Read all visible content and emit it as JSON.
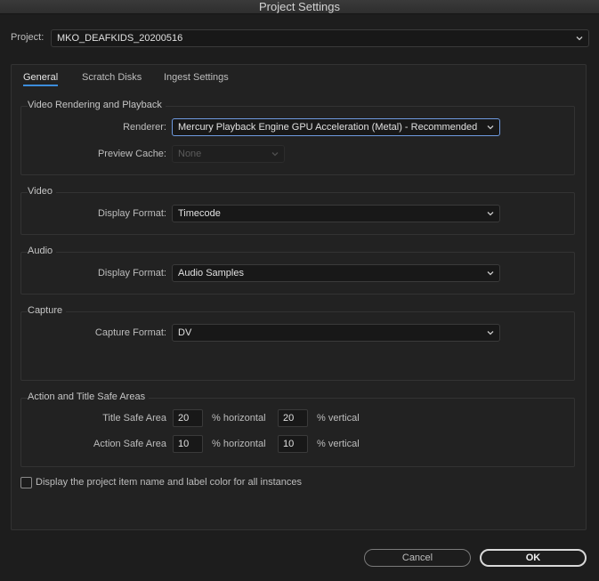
{
  "window": {
    "title": "Project Settings"
  },
  "project": {
    "label": "Project:",
    "value": "MKO_DEAFKIDS_20200516"
  },
  "tabs": [
    {
      "label": "General",
      "active": true
    },
    {
      "label": "Scratch Disks",
      "active": false
    },
    {
      "label": "Ingest Settings",
      "active": false
    }
  ],
  "video_rendering": {
    "title": "Video Rendering and Playback",
    "renderer_label": "Renderer:",
    "renderer_value": "Mercury Playback Engine GPU Acceleration (Metal) - Recommended",
    "preview_cache_label": "Preview Cache:",
    "preview_cache_value": "None"
  },
  "video": {
    "title": "Video",
    "display_format_label": "Display Format:",
    "display_format_value": "Timecode"
  },
  "audio": {
    "title": "Audio",
    "display_format_label": "Display Format:",
    "display_format_value": "Audio Samples"
  },
  "capture": {
    "title": "Capture",
    "capture_format_label": "Capture Format:",
    "capture_format_value": "DV"
  },
  "safe_areas": {
    "title": "Action and Title Safe Areas",
    "title_safe_label": "Title Safe Area",
    "title_safe_h": "20",
    "title_safe_v": "20",
    "action_safe_label": "Action Safe Area",
    "action_safe_h": "10",
    "action_safe_v": "10",
    "horizontal_unit": "% horizontal",
    "vertical_unit": "% vertical"
  },
  "display_item_name": {
    "label": "Display the project item name and label color for all instances",
    "checked": false
  },
  "buttons": {
    "cancel": "Cancel",
    "ok": "OK"
  },
  "colors": {
    "accent": "#3c8ddb",
    "focus_border": "#6f9be0",
    "background": "#1d1d1d",
    "panel": "#222222"
  }
}
